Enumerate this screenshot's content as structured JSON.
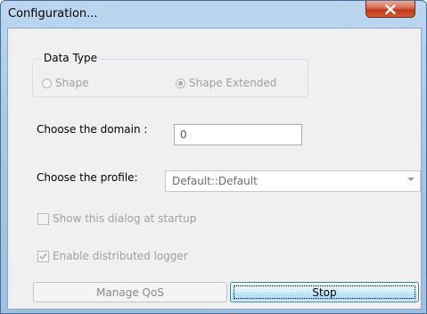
{
  "window": {
    "title": "Configuration..."
  },
  "data_type": {
    "legend": "Data Type",
    "options": [
      {
        "label": "Shape",
        "checked": false,
        "enabled": false
      },
      {
        "label": "Shape Extended",
        "checked": true,
        "enabled": false
      }
    ]
  },
  "domain": {
    "label": "Choose the domain :",
    "value": "0"
  },
  "profile": {
    "label": "Choose the profile:",
    "selected": "Default::Default"
  },
  "options": {
    "show_dialog_label": "Show this dialog at startup",
    "show_dialog_checked": false,
    "enable_logger_label": "Enable distributed logger",
    "enable_logger_checked": true
  },
  "buttons": {
    "manage_qos": "Manage QoS",
    "stop": "Stop"
  },
  "colors": {
    "title_bar": "#b3d1ee",
    "close_button": "#c94a2c",
    "dialog_background": "#f0f0f0",
    "disabled_text": "#a0a0a0",
    "default_button_border": "#3c7fb1"
  }
}
